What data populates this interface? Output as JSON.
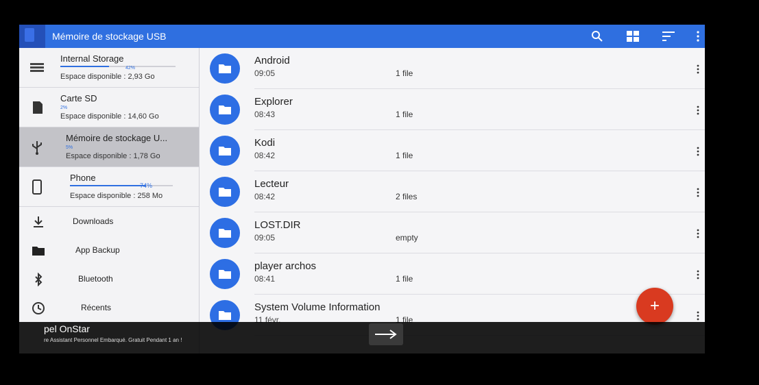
{
  "toolbar": {
    "title": "Mémoire de stockage USB",
    "icons": [
      "sd-card-icon",
      "search-icon",
      "grid-view-icon",
      "sort-icon",
      "more-vert-icon"
    ]
  },
  "storage": [
    {
      "name": "Internal Storage",
      "percent": "42%",
      "fill": 0.42,
      "free": "Espace disponible : 2,93 Go",
      "icon": "storage-icon"
    },
    {
      "name": "Carte SD",
      "percent": "2%",
      "fill": 0.02,
      "free": "Espace disponible : 14,60 Go",
      "icon": "sd-card-icon"
    },
    {
      "name": "Mémoire de stockage U...",
      "percent": "5%",
      "fill": 0.05,
      "free": "Espace disponible : 1,78 Go",
      "icon": "usb-icon",
      "active": true
    },
    {
      "name": "Phone",
      "percent": "74%",
      "fill": 0.74,
      "free": "Espace disponible : 258 Mo",
      "icon": "phone-icon"
    }
  ],
  "nav": [
    {
      "label": "Downloads",
      "icon": "download-icon"
    },
    {
      "label": "App Backup",
      "icon": "folder-icon"
    },
    {
      "label": "Bluetooth",
      "icon": "bluetooth-icon"
    },
    {
      "label": "Récents",
      "icon": "clock-icon"
    }
  ],
  "files": [
    {
      "name": "Android",
      "date": "09:05",
      "count": "1 file"
    },
    {
      "name": "Explorer",
      "date": "08:43",
      "count": "1 file"
    },
    {
      "name": "Kodi",
      "date": "08:42",
      "count": "1 file"
    },
    {
      "name": "Lecteur",
      "date": "08:42",
      "count": "2 files"
    },
    {
      "name": "LOST.DIR",
      "date": "09:05",
      "count": "empty"
    },
    {
      "name": "player archos",
      "date": "08:41",
      "count": "1 file"
    },
    {
      "name": "System Volume Information",
      "date": "11 févr.",
      "count": "1 file"
    }
  ],
  "fab": {
    "label": "+"
  },
  "overlay": {
    "title": "pel OnStar",
    "text": "re Assistant Personnel Embarqué. Gratuit Pendant 1 an !",
    "next_icon": "arrow-right-icon"
  },
  "colors": {
    "accent": "#2f6fe0",
    "fab": "#d93a20",
    "active_item": "#c3c3c8"
  }
}
